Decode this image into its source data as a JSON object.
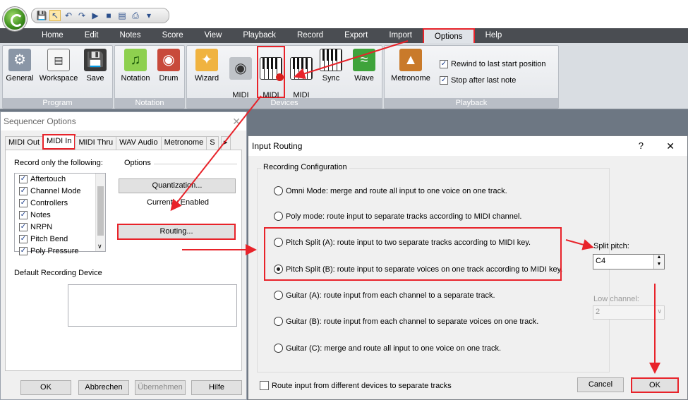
{
  "quick_access": {
    "icons": [
      "save-icon",
      "pointer-icon",
      "undo-icon",
      "redo-icon",
      "play-icon",
      "stop-icon",
      "mixer-icon",
      "print-icon",
      "dropdown-icon"
    ]
  },
  "menu": {
    "tabs": [
      "Home",
      "Edit",
      "Notes",
      "Score",
      "View",
      "Playback",
      "Record",
      "Export",
      "Import",
      "Options",
      "Help"
    ]
  },
  "ribbon": {
    "program": {
      "label": "Program",
      "buttons": [
        "General",
        "Workspace",
        "Save"
      ]
    },
    "notation": {
      "label": "Notation",
      "buttons": [
        "Notation",
        "Drum"
      ]
    },
    "devices": {
      "label": "Devices",
      "buttons": [
        "Wizard",
        "MIDI\nOut",
        "MIDI\nIn",
        "MIDI\nThru",
        "Sync",
        "Wave"
      ]
    },
    "playback": {
      "label": "Playback",
      "metronome": "Metronome",
      "rewind": "Rewind to last start position",
      "stop_after": "Stop after last note"
    }
  },
  "seq_dialog": {
    "title": "Sequencer Options",
    "tabs": [
      "MIDI Out",
      "MIDI In",
      "MIDI Thru",
      "WAV Audio",
      "Metronome",
      "S"
    ],
    "record_label": "Record only the following:",
    "record_items": [
      "Aftertouch",
      "Channel Mode",
      "Controllers",
      "Notes",
      "NRPN",
      "Pitch Bend",
      "Poly Pressure"
    ],
    "options_label": "Options",
    "quantization": "Quantization...",
    "currently": "Currently Enabled",
    "routing": "Routing...",
    "default_device": "Default Recording Device",
    "ok": "OK",
    "cancel": "Abbrechen",
    "apply": "Übernehmen",
    "help": "Hilfe"
  },
  "ir_dialog": {
    "title": "Input Routing",
    "help_q": "?",
    "close": "✕",
    "group": "Recording Configuration",
    "options": [
      "Omni Mode: merge and route all input to one voice on one track.",
      "Poly mode: route input to separate tracks according to MIDI channel.",
      "Pitch Split (A): route input to two separate tracks according to MIDI key.",
      "Pitch Split (B): route input to separate voices on one track according to MIDI key.",
      "Guitar (A): route input from each channel to a separate track.",
      "Guitar (B): route input from each channel to separate voices on one track.",
      "Guitar (C): merge and route all input to one voice on one track."
    ],
    "split_label": "Split pitch:",
    "split_value": "C4",
    "low_label": "Low channel:",
    "low_value": "2",
    "route_devices": "Route input from different devices to separate tracks",
    "cancel": "Cancel",
    "ok": "OK"
  }
}
